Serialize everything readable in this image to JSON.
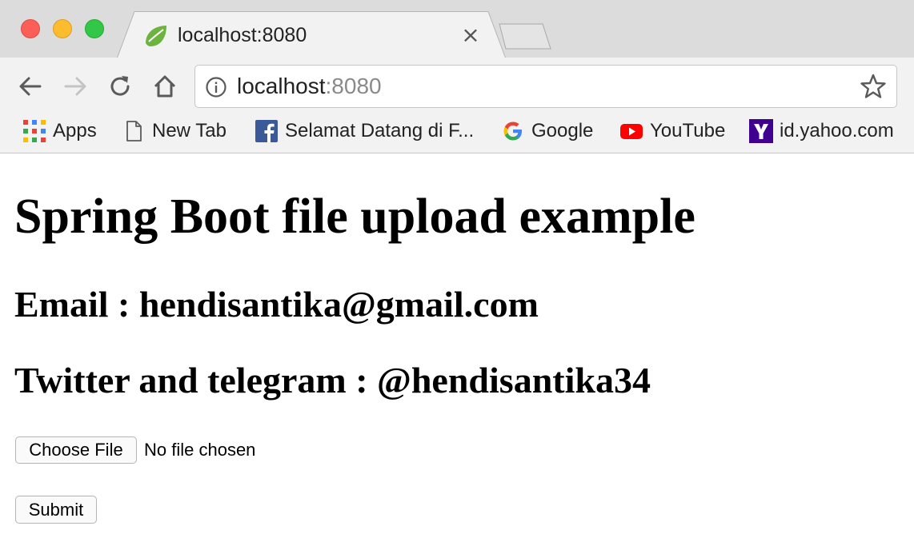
{
  "browser": {
    "tab_title": "localhost:8080",
    "tab_close": "×",
    "url_host": "localhost",
    "url_port": ":8080"
  },
  "bookmarks": [
    {
      "label": "Apps",
      "icon": "apps-grid-icon"
    },
    {
      "label": "New Tab",
      "icon": "page-icon"
    },
    {
      "label": "Selamat Datang di F...",
      "icon": "facebook-icon"
    },
    {
      "label": "Google",
      "icon": "google-icon"
    },
    {
      "label": "YouTube",
      "icon": "youtube-icon"
    },
    {
      "label": "id.yahoo.com",
      "icon": "yahoo-icon"
    }
  ],
  "page": {
    "title": "Spring Boot file upload example",
    "email": "Email : hendisantika@gmail.com",
    "social": "Twitter and telegram : @hendisantika34",
    "choose_file_label": "Choose File",
    "file_status": "No file chosen",
    "submit_label": "Submit"
  },
  "colors": {
    "close_red": "#fc5f57",
    "minimize_yellow": "#fdbc2e",
    "zoom_green": "#33c748",
    "spring_green": "#6db33f",
    "youtube_red": "#ff0000",
    "facebook_blue": "#3b5998",
    "yahoo_purple": "#400191"
  }
}
